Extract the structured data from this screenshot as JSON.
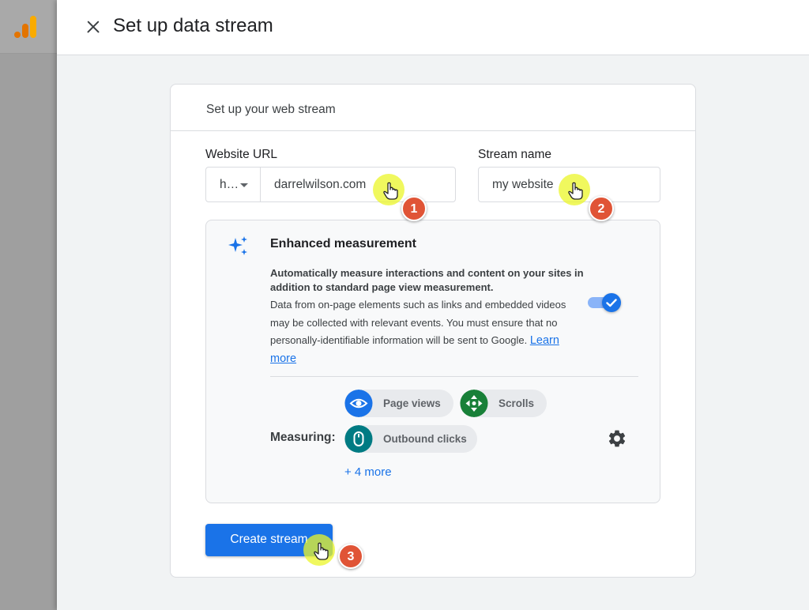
{
  "dialog": {
    "title": "Set up data stream"
  },
  "card": {
    "heading": "Set up your web stream",
    "website_url": {
      "label": "Website URL",
      "protocol_value": "h…",
      "value": "darrelwilson.com"
    },
    "stream_name": {
      "label": "Stream name",
      "value": "my website"
    },
    "enhanced_measurement": {
      "title": "Enhanced measurement",
      "bold_text": "Automatically measure interactions and content on your sites in addition to standard page view measurement.",
      "body_text": "Data from on-page elements such as links and embedded videos may be collected with relevant events. You must ensure that no personally-identifiable information will be sent to Google.",
      "learn_more": "Learn more",
      "toggle_on": true,
      "measuring_label": "Measuring:",
      "chips": [
        {
          "label": "Page views",
          "icon": "eye-icon",
          "color": "#1a73e8"
        },
        {
          "label": "Scrolls",
          "icon": "scroll-arrows-icon",
          "color": "#188038"
        },
        {
          "label": "Outbound clicks",
          "icon": "mouse-icon",
          "color": "#007b83"
        }
      ],
      "more_link": "+ 4 more"
    },
    "create_button": "Create stream"
  },
  "annotations": {
    "step_1": "1",
    "step_2": "2",
    "step_3": "3",
    "highlight_color": "#ebf528",
    "badge_color": "#e05436"
  },
  "colors": {
    "accent": "#1a73e8",
    "logo_orange": "#f9ab00",
    "logo_dark_orange": "#e37400"
  }
}
